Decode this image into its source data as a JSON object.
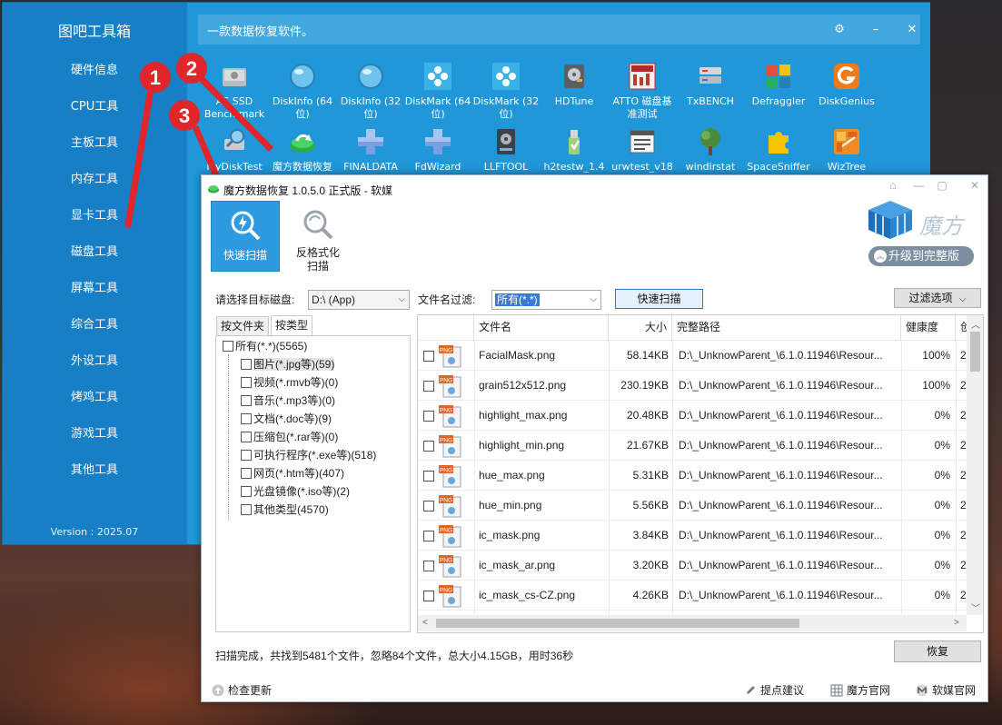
{
  "toolbox": {
    "title": "图吧工具箱",
    "version": "Version : 2025.07",
    "description": "一款数据恢复软件。",
    "controls": {
      "settings": "⚙",
      "minimize": "–",
      "close": "✕"
    },
    "sidebar": [
      {
        "label": "硬件信息"
      },
      {
        "label": "CPU工具"
      },
      {
        "label": "主板工具"
      },
      {
        "label": "内存工具"
      },
      {
        "label": "显卡工具"
      },
      {
        "label": "磁盘工具"
      },
      {
        "label": "屏幕工具"
      },
      {
        "label": "综合工具"
      },
      {
        "label": "外设工具"
      },
      {
        "label": "烤鸡工具"
      },
      {
        "label": "游戏工具"
      },
      {
        "label": "其他工具"
      }
    ],
    "tools_row1": [
      {
        "label": "AS SSD Bench mark",
        "icon": "drive-icon"
      },
      {
        "label": "DiskInfo (64位)",
        "icon": "globe-icon"
      },
      {
        "label": "DiskInfo (32位)",
        "icon": "globe-icon"
      },
      {
        "label": "DiskMark (64位)",
        "icon": "flower-icon"
      },
      {
        "label": "DiskMark (32位)",
        "icon": "flower-icon"
      },
      {
        "label": "HDTune",
        "icon": "harddisk-icon"
      },
      {
        "label": "ATTO 磁盘基准测试",
        "icon": "atto-icon"
      },
      {
        "label": "TxBENCH",
        "icon": "server-icon"
      },
      {
        "label": "Defraggler",
        "icon": "cubes-icon"
      },
      {
        "label": "DiskGenius",
        "icon": "diskgenius-icon"
      }
    ],
    "tools_row2": [
      {
        "label": "MyDiskTest",
        "icon": "magnifier-icon"
      },
      {
        "label": "魔方数据恢复",
        "icon": "recovery-icon"
      },
      {
        "label": "FINALDATA",
        "icon": "cross-icon"
      },
      {
        "label": "FdWizard",
        "icon": "cross-icon"
      },
      {
        "label": "LLFTOOL",
        "icon": "hdd-tool-icon"
      },
      {
        "label": "h2testw_1.4",
        "icon": "usb-icon"
      },
      {
        "label": "urwtest_v18",
        "icon": "window-icon"
      },
      {
        "label": "windirstat",
        "icon": "tree-icon"
      },
      {
        "label": "SpaceSniffer",
        "icon": "puzzle-icon"
      },
      {
        "label": "WizTree",
        "icon": "wiztree-icon"
      }
    ]
  },
  "annotations": [
    "1",
    "2",
    "3"
  ],
  "recovery": {
    "title": "魔方数据恢复 1.0.5.0 正式版 - 软媒",
    "quick_scan_tab": "快速扫描",
    "unformat_tab": "反格式化\n扫描",
    "brand": "魔方",
    "upgrade": "升级到完整版",
    "target_label": "请选择目标磁盘:",
    "target_value": "D:\\  (App)",
    "filter_label": "文件名过滤:",
    "filter_value": "所有(*.*)",
    "scan_button": "快速扫描",
    "filter_options": "过滤选项",
    "tabs": [
      "按文件夹",
      "按类型"
    ],
    "tree": {
      "root": "所有(*.*)(5565)",
      "children": [
        "图片(*.jpg等)(59)",
        "视频(*.rmvb等)(0)",
        "音乐(*.mp3等)(0)",
        "文档(*.doc等)(9)",
        "压缩包(*.rar等)(0)",
        "可执行程序(*.exe等)(518)",
        "网页(*.htm等)(407)",
        "光盘镜像(*.iso等)(2)",
        "其他类型(4570)"
      ]
    },
    "columns": [
      "文件名",
      "大小",
      "完整路径",
      "健康度",
      "创"
    ],
    "files": [
      {
        "name": "FacialMask.png",
        "size": "58.14KB",
        "path": "D:\\_UnknowParent_\\6.1.0.11946\\Resour...",
        "health": "100%",
        "extra": "2"
      },
      {
        "name": "grain512x512.png",
        "size": "230.19KB",
        "path": "D:\\_UnknowParent_\\6.1.0.11946\\Resour...",
        "health": "100%",
        "extra": "2"
      },
      {
        "name": "highlight_max.png",
        "size": "20.48KB",
        "path": "D:\\_UnknowParent_\\6.1.0.11946\\Resour...",
        "health": "0%",
        "extra": "2"
      },
      {
        "name": "highlight_min.png",
        "size": "21.67KB",
        "path": "D:\\_UnknowParent_\\6.1.0.11946\\Resour...",
        "health": "0%",
        "extra": "2"
      },
      {
        "name": "hue_max.png",
        "size": "5.31KB",
        "path": "D:\\_UnknowParent_\\6.1.0.11946\\Resour...",
        "health": "0%",
        "extra": "2"
      },
      {
        "name": "hue_min.png",
        "size": "5.56KB",
        "path": "D:\\_UnknowParent_\\6.1.0.11946\\Resour...",
        "health": "0%",
        "extra": "2"
      },
      {
        "name": "ic_mask.png",
        "size": "3.84KB",
        "path": "D:\\_UnknowParent_\\6.1.0.11946\\Resour...",
        "health": "0%",
        "extra": "2"
      },
      {
        "name": "ic_mask_ar.png",
        "size": "3.20KB",
        "path": "D:\\_UnknowParent_\\6.1.0.11946\\Resour...",
        "health": "0%",
        "extra": "2"
      },
      {
        "name": "ic_mask_cs-CZ.png",
        "size": "4.26KB",
        "path": "D:\\_UnknowParent_\\6.1.0.11946\\Resour...",
        "health": "0%",
        "extra": "2"
      }
    ],
    "file_icon_text": "PNG",
    "status": "扫描完成，共找到5481个文件，忽略84个文件，总大小4.15GB，用时36秒",
    "recover_button": "恢复",
    "footer": {
      "check_update": "检查更新",
      "feedback": "提点建议",
      "official_site": "魔方官网",
      "ruanmei_site": "软媒官网"
    }
  },
  "colors": {
    "toolbox_blue": "#1f97d8",
    "sidebar_blue": "#167fc6",
    "arrow_red": "#e0262b",
    "selection_blue": "#2e9be0"
  }
}
